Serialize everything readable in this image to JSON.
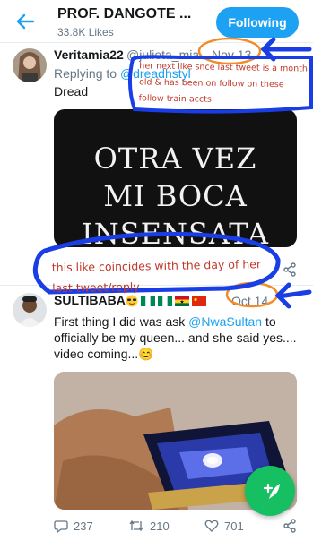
{
  "header": {
    "title": "PROF. DANGOTE ...",
    "likes": "33.8K Likes",
    "follow_label": "Following"
  },
  "tweet1": {
    "name": "Veritamia22",
    "handle": "@julieta_mia",
    "date": "Nov 13",
    "reply_prefix": "Replying to",
    "reply_mention": "@dreadhstyl",
    "text": "Dread",
    "media_lines": [
      "OTRA VEZ",
      "MI BOCA",
      "INSENSATA"
    ]
  },
  "tweet2": {
    "name": "SULTIBABA",
    "date": "Oct 14",
    "text_before": "First thing I did was ask ",
    "mention": "@NwaSultan",
    "text_after": " to officially be my queen... and she said yes.... video coming...😊",
    "stats": {
      "replies": "237",
      "retweets": "210",
      "likes": "701"
    }
  },
  "annotations": {
    "note1": "her next like snce last tweet is a month old & has been on follow on these follow train accts",
    "note2": "this like coincides with the day of her last tweet/reply"
  },
  "colors": {
    "accent": "#1da1f2",
    "fab": "#17bf63",
    "annotation_text": "#c0392b",
    "annotation_marker": "#1a3ee6",
    "circle_marker": "#f28c28"
  }
}
